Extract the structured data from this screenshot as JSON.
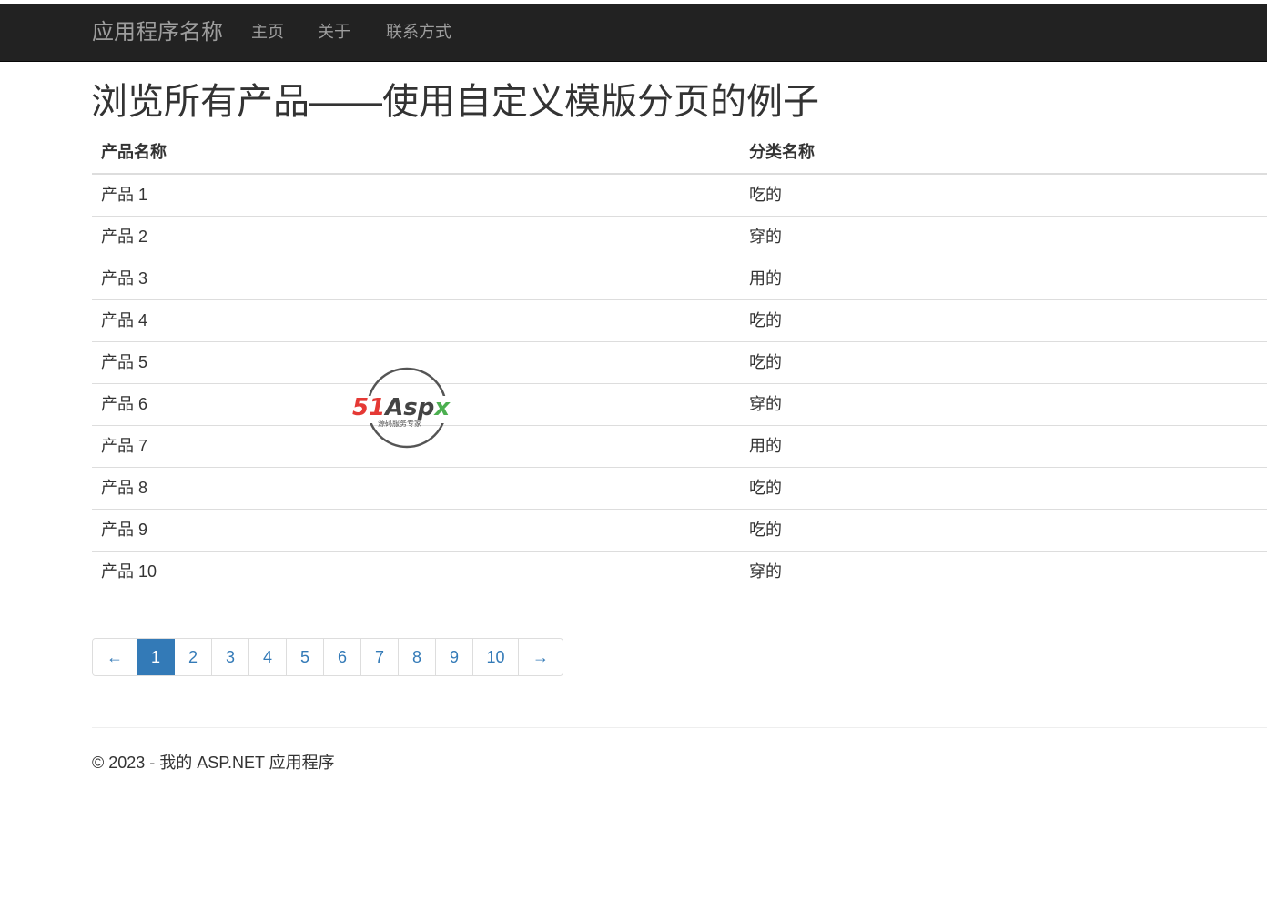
{
  "navbar": {
    "brand": "应用程序名称",
    "links": [
      "主页",
      "关于",
      "联系方式"
    ]
  },
  "page": {
    "title": "浏览所有产品——使用自定义模版分页的例子"
  },
  "table": {
    "headers": [
      "产品名称",
      "分类名称"
    ],
    "rows": [
      [
        "产品 1",
        "吃的"
      ],
      [
        "产品 2",
        "穿的"
      ],
      [
        "产品 3",
        "用的"
      ],
      [
        "产品 4",
        "吃的"
      ],
      [
        "产品 5",
        "吃的"
      ],
      [
        "产品 6",
        "穿的"
      ],
      [
        "产品 7",
        "用的"
      ],
      [
        "产品 8",
        "吃的"
      ],
      [
        "产品 9",
        "吃的"
      ],
      [
        "产品 10",
        "穿的"
      ]
    ]
  },
  "pagination": {
    "prev": "←",
    "pages": [
      "1",
      "2",
      "3",
      "4",
      "5",
      "6",
      "7",
      "8",
      "9",
      "10"
    ],
    "active": "1",
    "next": "→"
  },
  "watermark": {
    "logo_main": "51Aspx",
    "logo_sub": "源码服务专家"
  },
  "footer": {
    "text": "© 2023 - 我的 ASP.NET 应用程序"
  },
  "colors": {
    "navbar_bg": "#222222",
    "nav_text": "#9d9d9d",
    "link": "#337ab7",
    "active_page_bg": "#337ab7",
    "watermark_red": "#e53935",
    "watermark_green": "#4caf50"
  }
}
